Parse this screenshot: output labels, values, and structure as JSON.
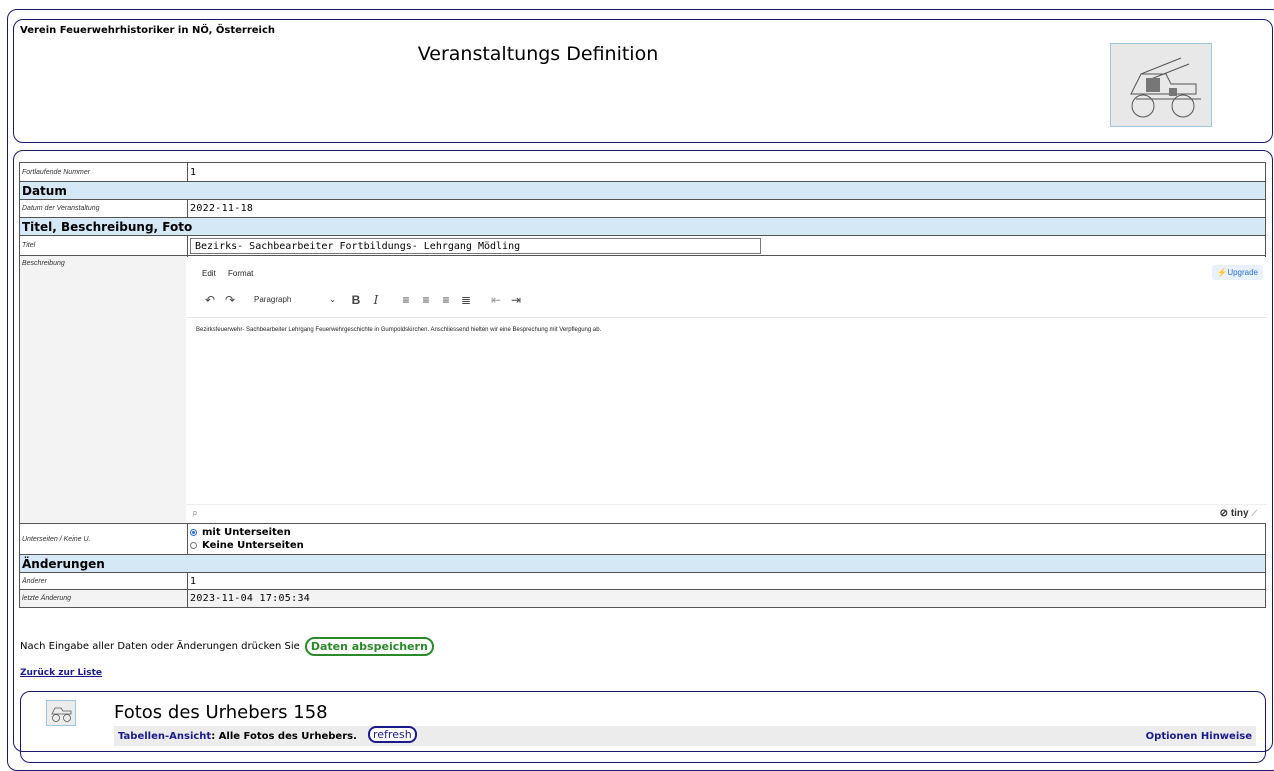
{
  "header": {
    "org": "Verein Feuerwehrhistoriker in NÖ, Österreich",
    "title": "Veranstaltungs Definition"
  },
  "form": {
    "fortlaufende_label": "Fortlaufende Nummer",
    "fortlaufende_value": "1",
    "section_datum": "Datum",
    "datum_label": "Datum der Veranstaltung",
    "datum_value": "2022-11-18",
    "section_titel": "Titel, Beschreibung, Foto",
    "titel_label": "Titel",
    "titel_value": "Bezirks- Sachbearbeiter Fortbildungs- Lehrgang Mödling",
    "beschreibung_label": "Beschreibung",
    "unterseiten_label": "Unterseiten / Keine U.",
    "radio_mit": "mit Unterseiten",
    "radio_keine": "Keine Unterseiten",
    "section_aenderungen": "Änderungen",
    "aenderer_label": "Änderer",
    "aenderer_value": "1",
    "letzte_label": "letzte Änderung",
    "letzte_value": "2023-11-04 17:05:34"
  },
  "editor": {
    "menu_edit": "Edit",
    "menu_format": "Format",
    "upgrade": "Upgrade",
    "paragraph": "Paragraph",
    "content": "Bezirksfeuerwehr- Sachbearbeiter Lehrgang Feuerwehrgeschichte in Gumpoldskirchen. Anschliessend hielten wir eine Besprechung mit Verpflegung ab.",
    "status_path": "p",
    "brand": "tiny"
  },
  "actions": {
    "note": "Nach Eingabe aller Daten oder Änderungen drücken Sie",
    "save": "Daten abspeichern",
    "back": "Zurück zur Liste"
  },
  "fotos": {
    "title": "Fotos des Urhebers 158",
    "view_link": "Tabellen-Ansicht",
    "view_text": ": Alle Fotos des Urhebers.",
    "refresh": "refresh",
    "options": "Optionen Hinweise"
  }
}
